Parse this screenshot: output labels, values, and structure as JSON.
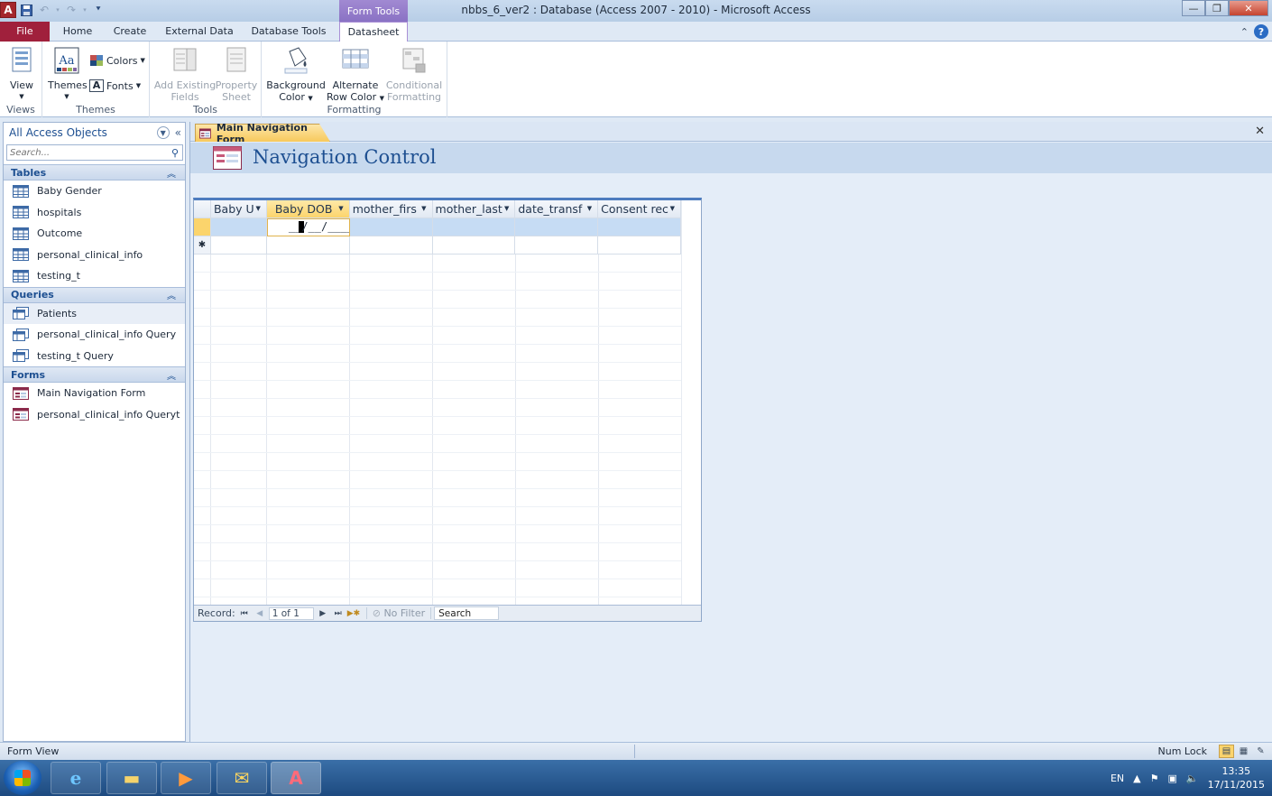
{
  "window": {
    "title": "nbbs_6_ver2 : Database (Access 2007 - 2010)  -  Microsoft Access",
    "context_tab_group": "Form Tools",
    "app_logo_letter": "A",
    "controls": {
      "minimize": "—",
      "maximize": "❐",
      "close": "✕"
    }
  },
  "ribbon_tabs": [
    "File",
    "Home",
    "Create",
    "External Data",
    "Database Tools",
    "Datasheet"
  ],
  "ribbon": {
    "groups": {
      "views": "Views",
      "themes": "Themes",
      "tools": "Tools",
      "formatting": "Formatting"
    },
    "view_label": "View",
    "themes_label": "Themes",
    "colors_label": "Colors",
    "fonts_label": "Fonts",
    "add_existing_fields": [
      "Add Existing",
      "Fields"
    ],
    "property_sheet": [
      "Property",
      "Sheet"
    ],
    "background_color": [
      "Background",
      "Color"
    ],
    "alternate_row_color": [
      "Alternate",
      "Row Color"
    ],
    "conditional_formatting": [
      "Conditional",
      "Formatting"
    ]
  },
  "nav_pane": {
    "title": "All Access Objects",
    "search_placeholder": "Search...",
    "sections": {
      "tables": {
        "label": "Tables",
        "items": [
          "Baby Gender",
          "hospitals",
          "Outcome",
          "personal_clinical_info",
          "testing_t"
        ]
      },
      "queries": {
        "label": "Queries",
        "items": [
          "Patients",
          "personal_clinical_info Query",
          "testing_t Query"
        ]
      },
      "forms": {
        "label": "Forms",
        "items": [
          "Main Navigation Form",
          "personal_clinical_info Queryt"
        ]
      }
    }
  },
  "document": {
    "tab_label": "Main Navigation Form",
    "form_title": "Navigation Control",
    "datasheet": {
      "columns": [
        "Baby U",
        "Baby DOB",
        "mother_firs",
        "mother_last",
        "date_transf",
        "Consent rec"
      ],
      "active_column": 1,
      "editing_value_left": "__",
      "editing_value_right": "/__/____",
      "new_row_marker": "✱",
      "record_label": "Record:",
      "record_position": "1 of 1",
      "filter_label": "No Filter",
      "search_label": "Search"
    }
  },
  "status_bar": {
    "left": "Form View",
    "numlock": "Num Lock"
  },
  "taskbar": {
    "input_language": "EN",
    "time": "13:35",
    "date": "17/11/2015"
  }
}
